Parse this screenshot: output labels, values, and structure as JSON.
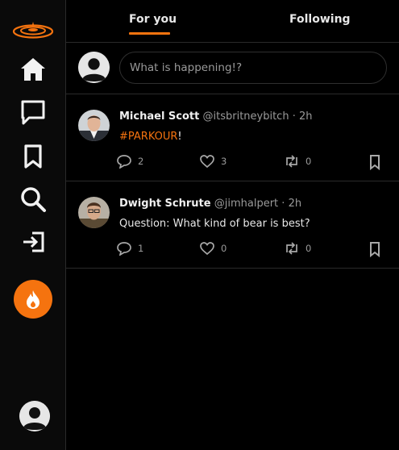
{
  "tabs": {
    "for_you": "For you",
    "following": "Following"
  },
  "composer": {
    "placeholder": "What is happening!?"
  },
  "colors": {
    "accent": "#f5730f",
    "background": "#000000",
    "divider": "#2a2a2a"
  },
  "sidebar": {
    "items": [
      {
        "name": "home",
        "icon": "home-icon"
      },
      {
        "name": "messages",
        "icon": "message-icon"
      },
      {
        "name": "bookmarks",
        "icon": "bookmark-icon"
      },
      {
        "name": "search",
        "icon": "search-icon"
      },
      {
        "name": "logout",
        "icon": "login-icon"
      }
    ],
    "fab_icon": "flame-icon",
    "logo_icon": "ripple-logo-icon",
    "profile_icon": "user-avatar-icon"
  },
  "posts": [
    {
      "name": "Michael Scott",
      "handle": "@itsbritneybitch",
      "separator": "·",
      "time": "2h",
      "hashtag": "#PARKOUR",
      "text": "!",
      "replies": "2",
      "likes": "3",
      "reposts": "0"
    },
    {
      "name": "Dwight Schrute",
      "handle": "@jimhalpert",
      "separator": "·",
      "time": "2h",
      "hashtag": "",
      "text": "Question: What kind of bear is best?",
      "replies": "1",
      "likes": "0",
      "reposts": "0"
    }
  ]
}
